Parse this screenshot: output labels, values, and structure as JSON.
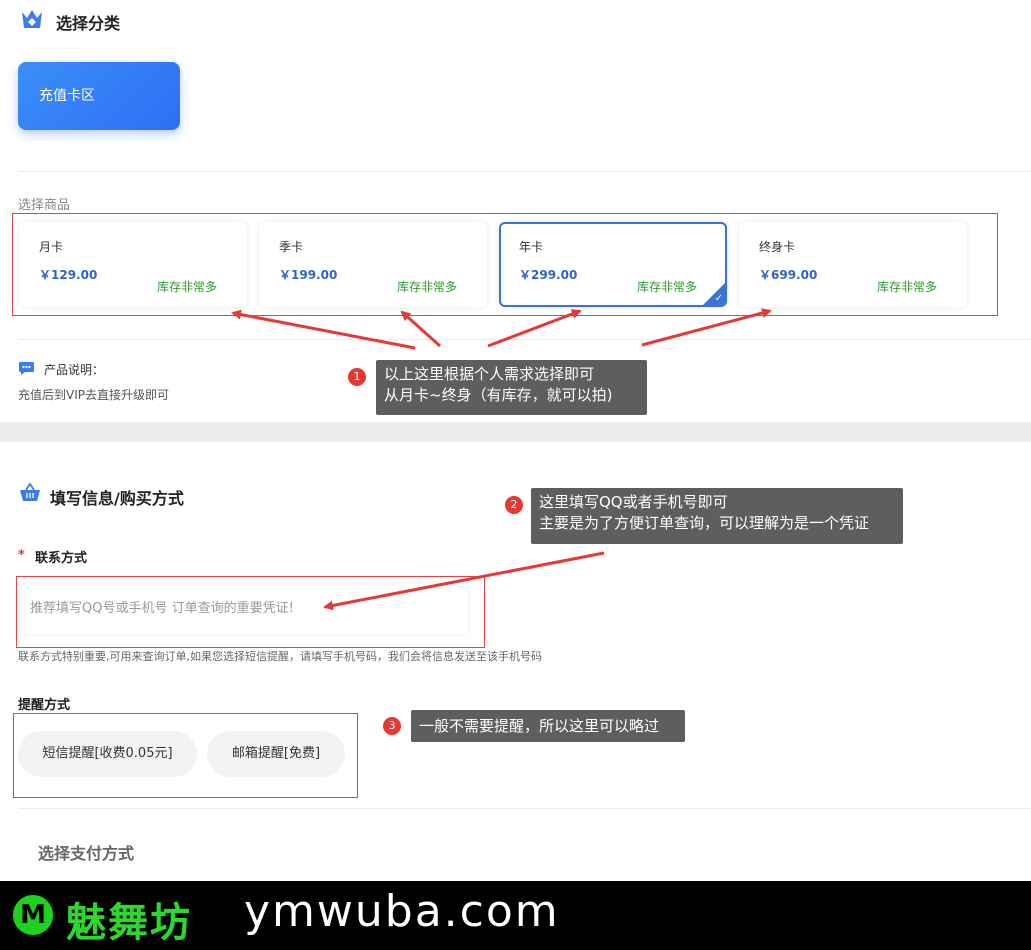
{
  "category_section": {
    "title": "选择分类",
    "card_label": "充值卡区"
  },
  "product_section": {
    "title": "选择商品",
    "products": [
      {
        "name": "月卡",
        "price": "￥129.00",
        "stock": "库存非常多",
        "selected": false
      },
      {
        "name": "季卡",
        "price": "￥199.00",
        "stock": "库存非常多",
        "selected": false
      },
      {
        "name": "年卡",
        "price": "￥299.00",
        "stock": "库存非常多",
        "selected": true
      },
      {
        "name": "终身卡",
        "price": "￥699.00",
        "stock": "库存非常多",
        "selected": false
      }
    ],
    "desc_title": "产品说明：",
    "desc_text": "充值后到VIP去直接升级即可"
  },
  "annotations": {
    "note1": {
      "badge": "1",
      "line1": "以上这里根据个人需求选择即可",
      "line2": "从月卡~终身（有库存，就可以拍)"
    },
    "note2": {
      "badge": "2",
      "line1": "这里填写QQ或者手机号即可",
      "line2": "主要是为了方便订单查询，可以理解为是一个凭证"
    },
    "note3": {
      "badge": "3",
      "line1": "一般不需要提醒，所以这里可以略过"
    }
  },
  "form_section": {
    "title": "填写信息/购买方式",
    "contact_required": "*",
    "contact_label": "联系方式",
    "contact_placeholder": "推荐填写QQ号或手机号 订单查询的重要凭证!",
    "contact_hint": "联系方式特别重要,可用来查询订单,如果您选择短信提醒，请填写手机号码，我们会将信息发送至该手机号码",
    "remind_label": "提醒方式",
    "remind_options": [
      "短信提醒[收费0.05元]",
      "邮箱提醒[免费]"
    ],
    "payment_title": "选择支付方式"
  },
  "footer": {
    "logo_letter": "M",
    "brand_cn": "魅舞坊",
    "brand_en": "ymwuba.com"
  },
  "colors": {
    "accent": "#2f6ef5",
    "stock_green": "#2a9d2a",
    "annotation_red": "#e53935"
  }
}
